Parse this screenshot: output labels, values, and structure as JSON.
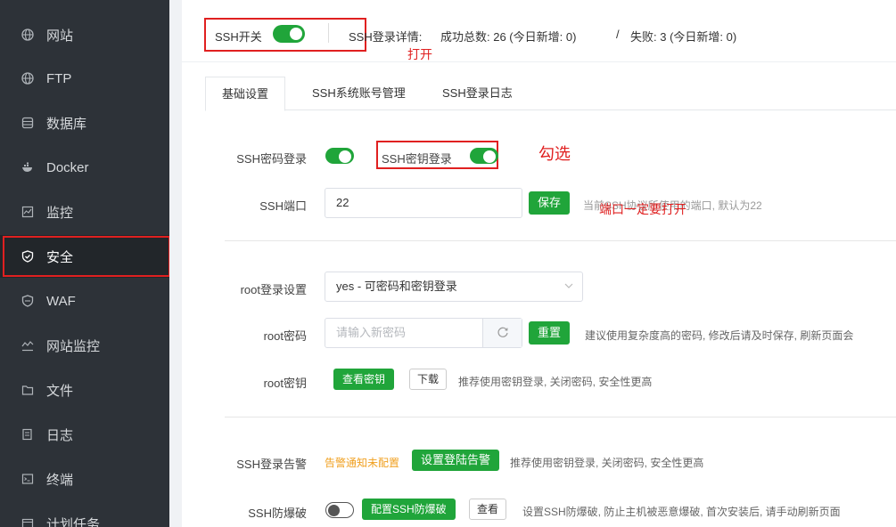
{
  "sidebar": {
    "items": [
      {
        "label": "网站",
        "icon": "globe-icon"
      },
      {
        "label": "FTP",
        "icon": "globe-icon"
      },
      {
        "label": "数据库",
        "icon": "database-icon"
      },
      {
        "label": "Docker",
        "icon": "docker-icon"
      },
      {
        "label": "监控",
        "icon": "monitor-icon"
      },
      {
        "label": "安全",
        "icon": "shield-check-icon"
      },
      {
        "label": "WAF",
        "icon": "shield-icon"
      },
      {
        "label": "网站监控",
        "icon": "chart-icon"
      },
      {
        "label": "文件",
        "icon": "folder-icon"
      },
      {
        "label": "日志",
        "icon": "log-icon"
      },
      {
        "label": "终端",
        "icon": "terminal-icon"
      },
      {
        "label": "计划任务",
        "icon": "calendar-icon"
      }
    ],
    "active_index": 5
  },
  "topbar": {
    "ssh_switch_label": "SSH开关",
    "ssh_switch_on": true,
    "login_detail_label": "SSH登录详情:",
    "success_text": "成功总数: 26 (今日新增: 0)",
    "separator": "/",
    "fail_text": "失败: 3 (今日新增: 0)",
    "annotation_open": "打开"
  },
  "tabs": [
    "基础设置",
    "SSH系统账号管理",
    "SSH登录日志"
  ],
  "basic": {
    "password_login_label": "SSH密码登录",
    "password_login_on": true,
    "key_login_label": "SSH密钥登录",
    "key_login_on": true,
    "annotation_check": "勾选",
    "port_label": "SSH端口",
    "port_value": "22",
    "save_button": "保存",
    "port_note": "当前SSH协议所使用的端口, 默认为22",
    "port_annotation": "端口一定要打开"
  },
  "root": {
    "login_setting_label": "root登录设置",
    "login_setting_value": "yes - 可密码和密钥登录",
    "password_label": "root密码",
    "password_placeholder": "请输入新密码",
    "reset_button": "重置",
    "password_note": "建议使用复杂度高的密码, 修改后请及时保存, 刷新页面会",
    "key_label": "root密钥",
    "view_key_button": "查看密钥",
    "download_button": "下载",
    "key_note": "推荐使用密钥登录, 关闭密码, 安全性更高"
  },
  "alerts": {
    "alert_label": "SSH登录告警",
    "alert_status": "告警通知未配置",
    "alert_button": "设置登陆告警",
    "alert_note": "推荐使用密钥登录, 关闭密码, 安全性更高",
    "brute_label": "SSH防爆破",
    "brute_on": false,
    "brute_config_button": "配置SSH防爆破",
    "brute_view_button": "查看",
    "brute_note": "设置SSH防爆破, 防止主机被恶意爆破, 首次安装后, 请手动刷新页面"
  },
  "colors": {
    "accent": "#20a53a",
    "danger": "#e02020",
    "sidebar_bg": "#2d3238",
    "warning": "#f0a020"
  }
}
